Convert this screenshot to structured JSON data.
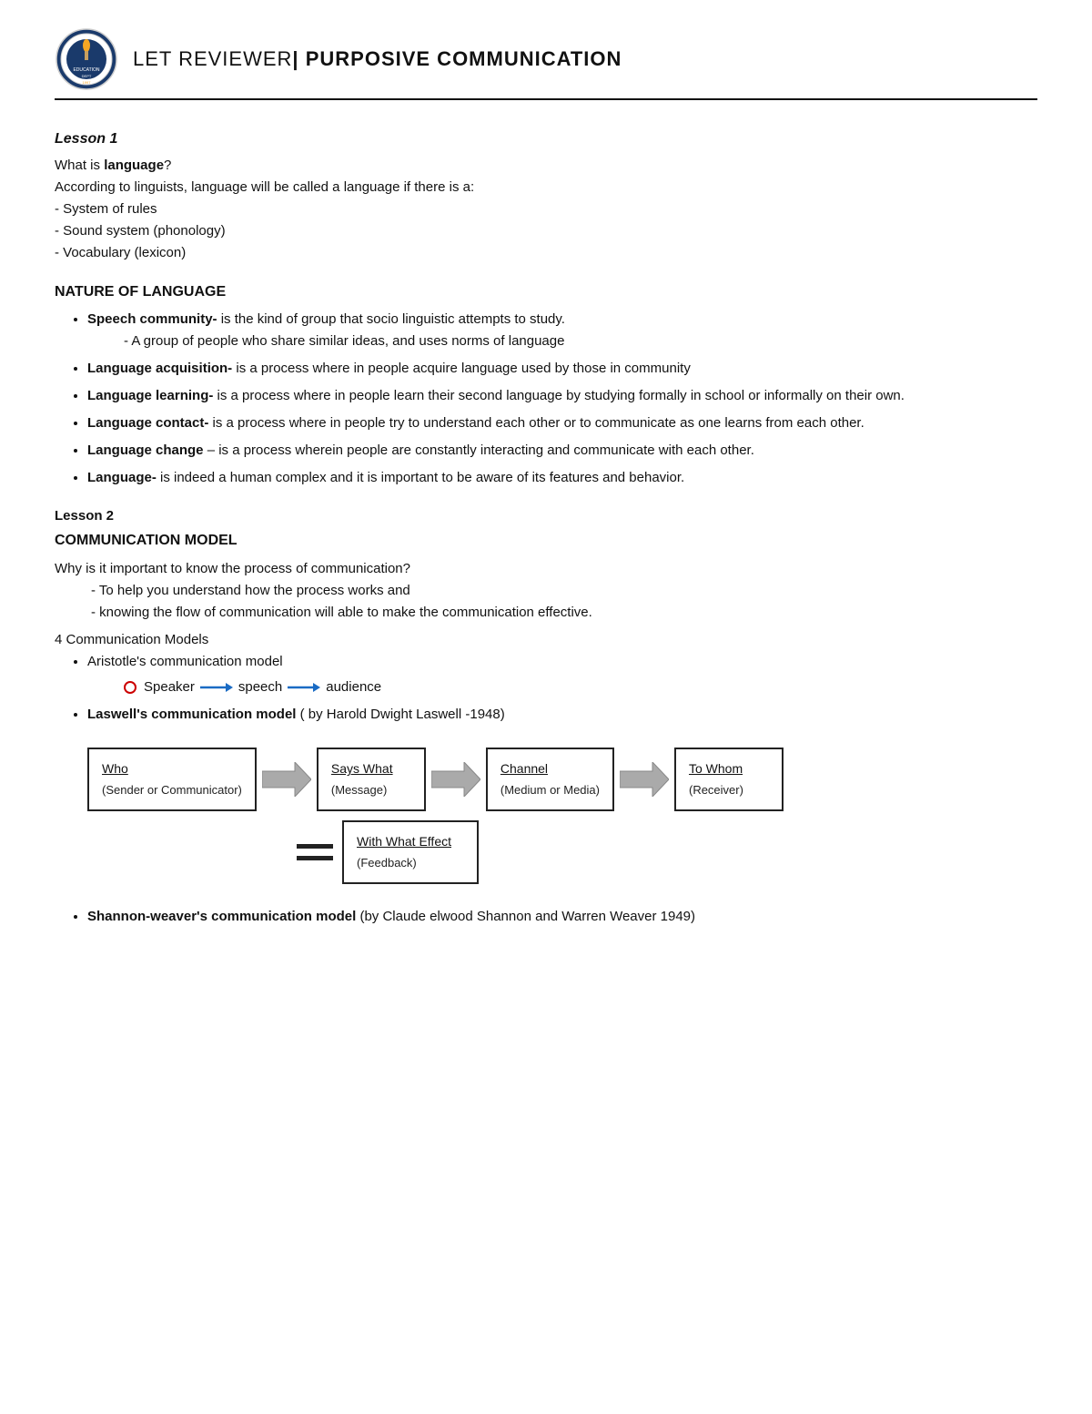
{
  "header": {
    "title_part1": "LET REVIEWER",
    "title_separator": "| ",
    "title_part2": "PURPOSIVE COMMUNICATION"
  },
  "lesson1": {
    "title": "Lesson 1",
    "what_is_language": "What is ",
    "language_word": "language",
    "question_mark": "?",
    "intro": "According to linguists, language will be called a language if there is a:",
    "bullets": [
      "- System of rules",
      "- Sound system (phonology)",
      "- Vocabulary (lexicon)"
    ],
    "nature_heading": "NATURE OF LANGUAGE",
    "nature_items": [
      {
        "term": "Speech community-",
        "definition": " is the kind of group that socio linguistic attempts to study.",
        "sub": "- A group of people who share similar ideas, and uses norms of language"
      },
      {
        "term": "Language acquisition-",
        "definition": " is a process where in people acquire language used by those in community"
      },
      {
        "term": "Language learning-",
        "definition": " is a process where in people learn their second language by studying formally in school or informally on their own."
      },
      {
        "term": "Language contact-",
        "definition": " is a process where in people try to understand each other or to communicate as one learns from each other."
      },
      {
        "term": "Language change",
        "definition": " – is a process wherein people are constantly interacting and communicate with each other."
      },
      {
        "term": "Language-",
        "definition": " is indeed a human complex and it is important to be aware of its features and behavior."
      }
    ]
  },
  "lesson2": {
    "title": "Lesson 2",
    "comm_model_heading": "COMMUNICATION MODEL",
    "why_important": "Why is it important to know the process of communication?",
    "reason1": "- To help you understand how the process works and",
    "reason2": "- knowing the flow of communication will able to make the communication effective.",
    "four_models": "4 Communication Models",
    "aristotle_label": "Aristotle's communication model",
    "aristotle_speaker": "Speaker",
    "aristotle_speech": "speech",
    "aristotle_audience": "audience",
    "laswell_label": "Laswell's communication model",
    "laswell_sub": " ( by Harold Dwight Laswell -1948)",
    "diagram": {
      "box1_title": "Who",
      "box1_sub": "(Sender or Communicator)",
      "box2_title": "Says What",
      "box2_sub": "(Message)",
      "box3_title": "Channel",
      "box3_sub": "(Medium or Media)",
      "box4_title": "To Whom",
      "box4_sub": "(Receiver)",
      "box5_title": "With What Effect",
      "box5_sub": "(Feedback)"
    },
    "shannon_label": "Shannon-weaver's communication model",
    "shannon_sub": " (by Claude elwood Shannon and Warren Weaver 1949)"
  }
}
